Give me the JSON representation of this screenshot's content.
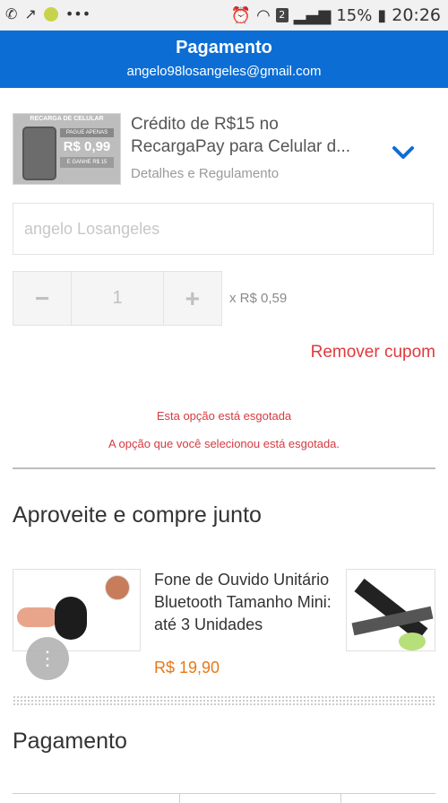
{
  "status_bar": {
    "battery": "15%",
    "time": "20:26",
    "notif_count": "2",
    "dots": "•••"
  },
  "header": {
    "title": "Pagamento",
    "email": "angelo98losangeles@gmail.com"
  },
  "product": {
    "title_line1": "Crédito de R$15 no",
    "title_line2": "RecargaPay para Celular d...",
    "details_link": "Detalhes e Regulamento",
    "thumb_heading": "RECARGA DE CELULAR",
    "thumb_badge": "PAGUE APENAS",
    "thumb_price": "R$ 0,99",
    "thumb_bottom": "E GANHE R$ 15"
  },
  "name_field": {
    "placeholder": "angelo Losangeles"
  },
  "quantity": {
    "minus": "−",
    "value": "1",
    "plus": "+",
    "unit_price": "x R$ 0,59"
  },
  "coupon": {
    "remove_label": "Remover cupom"
  },
  "messages": {
    "out_of_stock": "Esta opção está esgotada",
    "selected_out_of_stock": "A opção que você selecionou está esgotada."
  },
  "recommendations": {
    "title": "Aproveite e compre junto",
    "items": [
      {
        "name": "Fone de Ouvido Unitário Bluetooth Tamanho Mini: até 3 Unidades",
        "price": "R$ 19,90"
      }
    ]
  },
  "payment": {
    "title": "Pagamento"
  },
  "colors": {
    "header_bg": "#0c6ed5",
    "error_red": "#e0393e",
    "price_orange": "#e67817",
    "chevron_blue": "#0c6ed5"
  }
}
